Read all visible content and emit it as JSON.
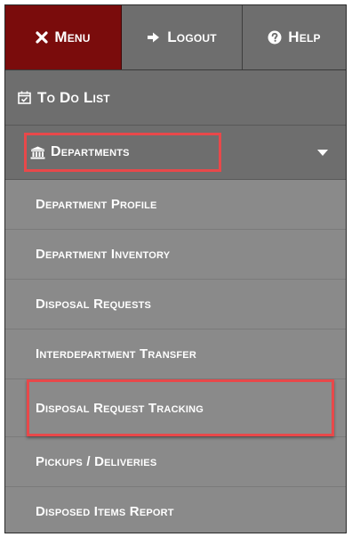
{
  "topbar": {
    "menu_label": "Menu",
    "logout_label": "Logout",
    "help_label": "Help"
  },
  "nav": {
    "todo_label": "To Do List",
    "departments_label": "Departments",
    "submenu": [
      "Department Profile",
      "Department Inventory",
      "Disposal Requests",
      "Interdepartment Transfer",
      "Disposal Request Tracking",
      "Pickups / Deliveries",
      "Disposed Items Report"
    ]
  },
  "colors": {
    "menu_active_bg": "#7a0c0c",
    "highlight_border": "#e8484a"
  },
  "icons": {
    "menu": "close-icon",
    "logout": "sign-out-icon",
    "help": "question-circle-icon",
    "todo": "calendar-check-icon",
    "departments": "institution-icon",
    "expand": "caret-down-icon"
  }
}
